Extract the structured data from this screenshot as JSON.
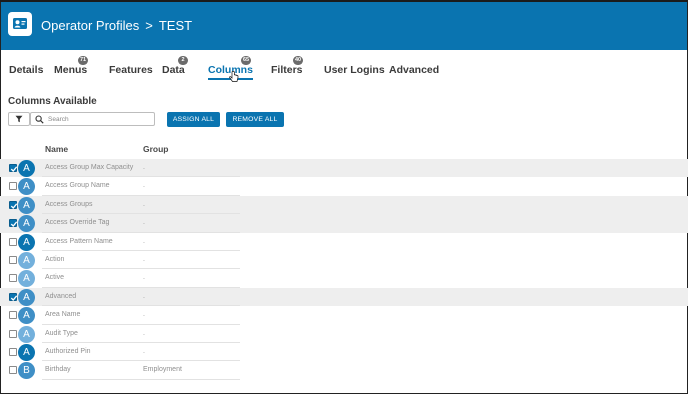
{
  "header": {
    "title": "Operator Profiles",
    "separator": ">",
    "record": "TEST",
    "logo_icon": "profile-card-icon"
  },
  "tabs": [
    {
      "label": "Details",
      "badge": null
    },
    {
      "label": "Menus",
      "badge": "71"
    },
    {
      "label": "Features",
      "badge": null
    },
    {
      "label": "Data",
      "badge": "2"
    },
    {
      "label": "Columns",
      "badge": "65",
      "active": true
    },
    {
      "label": "Filters",
      "badge": "40"
    },
    {
      "label": "User Logins",
      "badge": null
    },
    {
      "label": "Advanced",
      "badge": null
    }
  ],
  "section": {
    "title": "Columns Available"
  },
  "search": {
    "placeholder": "Search",
    "value": ""
  },
  "buttons": {
    "assign_all": "ASSIGN ALL",
    "remove_all": "REMOVE ALL"
  },
  "table": {
    "headers": {
      "name": "Name",
      "group": "Group"
    },
    "rows": [
      {
        "letter": "A",
        "name": "Access Group Max Capacity",
        "group": ".",
        "checked": true
      },
      {
        "letter": "A",
        "name": "Access Group Name",
        "group": ".",
        "checked": false
      },
      {
        "letter": "A",
        "name": "Access Groups",
        "group": ".",
        "checked": true
      },
      {
        "letter": "A",
        "name": "Access Override Tag",
        "group": ".",
        "checked": true
      },
      {
        "letter": "A",
        "name": "Access Pattern Name",
        "group": ".",
        "checked": false
      },
      {
        "letter": "A",
        "name": "Action",
        "group": ".",
        "checked": false
      },
      {
        "letter": "A",
        "name": "Active",
        "group": ".",
        "checked": false
      },
      {
        "letter": "A",
        "name": "Advanced",
        "group": ".",
        "checked": true
      },
      {
        "letter": "A",
        "name": "Area Name",
        "group": ".",
        "checked": false
      },
      {
        "letter": "A",
        "name": "Audit Type",
        "group": ".",
        "checked": false
      },
      {
        "letter": "A",
        "name": "Authorized Pin",
        "group": ".",
        "checked": false
      },
      {
        "letter": "B",
        "name": "Birthday",
        "group": "Employment",
        "checked": false
      }
    ]
  },
  "colors": {
    "brand": "#0a74b0",
    "avatar_dark": "#0a74b0",
    "avatar_mid": "#3f8fc6",
    "avatar_light": "#73b0dc",
    "row_shade": "#eeeeee",
    "badge": "#6b6b6b"
  }
}
